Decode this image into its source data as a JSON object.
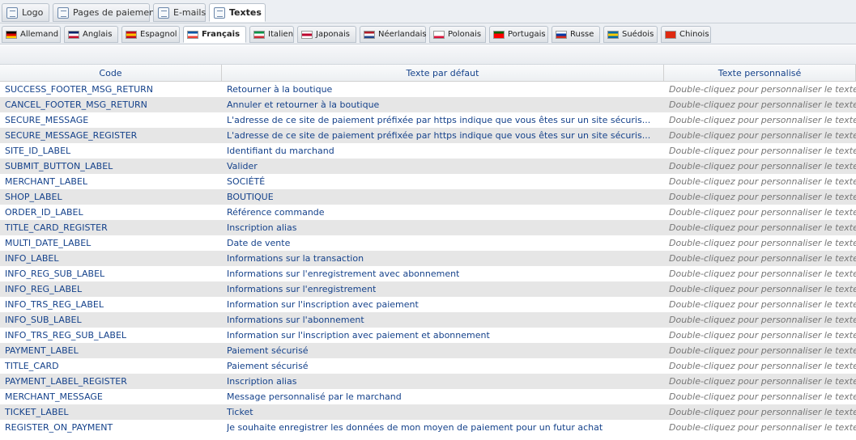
{
  "main_tabs": [
    {
      "label": "Logo",
      "icon": "image-icon"
    },
    {
      "label": "Pages de paiement",
      "icon": "page-edit-icon"
    },
    {
      "label": "E-mails",
      "icon": "email-icon"
    },
    {
      "label": "Textes",
      "icon": "text-icon",
      "active": true
    }
  ],
  "language_tabs": [
    {
      "label": "Allemand",
      "flag": [
        "#000000",
        "#dd0000",
        "#ffce00"
      ]
    },
    {
      "label": "Anglais",
      "flag": [
        "#012169",
        "#ffffff",
        "#c8102e"
      ]
    },
    {
      "label": "Espagnol",
      "flag": [
        "#c60b1e",
        "#ffc400",
        "#c60b1e"
      ]
    },
    {
      "label": "Français",
      "flag": [
        "#0055a4",
        "#ffffff",
        "#ef4135"
      ],
      "active": true
    },
    {
      "label": "Italien",
      "flag": [
        "#009246",
        "#ffffff",
        "#ce2b37"
      ]
    },
    {
      "label": "Japonais",
      "flag": [
        "#ffffff",
        "#bc002d",
        "#ffffff"
      ]
    },
    {
      "label": "Néerlandais",
      "flag": [
        "#ae1c28",
        "#ffffff",
        "#21468b"
      ]
    },
    {
      "label": "Polonais",
      "flag": [
        "#ffffff",
        "#ffffff",
        "#dc143c"
      ]
    },
    {
      "label": "Portugais",
      "flag": [
        "#006600",
        "#ff0000",
        "#ff0000"
      ]
    },
    {
      "label": "Russe",
      "flag": [
        "#ffffff",
        "#0039a6",
        "#d52b1e"
      ]
    },
    {
      "label": "Suédois",
      "flag": [
        "#006aa7",
        "#fecc00",
        "#006aa7"
      ]
    },
    {
      "label": "Chinois",
      "flag": [
        "#de2910",
        "#de2910",
        "#de2910"
      ]
    }
  ],
  "grid": {
    "headers": {
      "code": "Code",
      "default": "Texte par défaut",
      "custom": "Texte personnalisé"
    },
    "rows": [
      {
        "code": "SUCCESS_FOOTER_MSG_RETURN",
        "default": "Retourner à la boutique",
        "custom": "Double-cliquez pour personnaliser le texte"
      },
      {
        "code": "CANCEL_FOOTER_MSG_RETURN",
        "default": "Annuler et retourner à la boutique",
        "custom": "Double-cliquez pour personnaliser le texte"
      },
      {
        "code": "SECURE_MESSAGE",
        "default": "L'adresse de ce site de paiement préfixée par https indique que vous êtes sur un site sécuris...",
        "custom": "Double-cliquez pour personnaliser le texte"
      },
      {
        "code": "SECURE_MESSAGE_REGISTER",
        "default": "L'adresse de ce site de paiement préfixée par https indique que vous êtes sur un site sécuris...",
        "custom": "Double-cliquez pour personnaliser le texte"
      },
      {
        "code": "SITE_ID_LABEL",
        "default": "Identifiant du marchand",
        "custom": "Double-cliquez pour personnaliser le texte"
      },
      {
        "code": "SUBMIT_BUTTON_LABEL",
        "default": "Valider",
        "custom": "Double-cliquez pour personnaliser le texte"
      },
      {
        "code": "MERCHANT_LABEL",
        "default": "SOCIÉTÉ",
        "custom": "Double-cliquez pour personnaliser le texte"
      },
      {
        "code": "SHOP_LABEL",
        "default": "BOUTIQUE",
        "custom": "Double-cliquez pour personnaliser le texte"
      },
      {
        "code": "ORDER_ID_LABEL",
        "default": "Référence commande",
        "custom": "Double-cliquez pour personnaliser le texte"
      },
      {
        "code": "TITLE_CARD_REGISTER",
        "default": "Inscription alias",
        "custom": "Double-cliquez pour personnaliser le texte"
      },
      {
        "code": "MULTI_DATE_LABEL",
        "default": "Date de vente",
        "custom": "Double-cliquez pour personnaliser le texte"
      },
      {
        "code": "INFO_LABEL",
        "default": "Informations sur la transaction",
        "custom": "Double-cliquez pour personnaliser le texte"
      },
      {
        "code": "INFO_REG_SUB_LABEL",
        "default": "Informations sur l'enregistrement avec abonnement",
        "custom": "Double-cliquez pour personnaliser le texte"
      },
      {
        "code": "INFO_REG_LABEL",
        "default": "Informations sur l'enregistrement",
        "custom": "Double-cliquez pour personnaliser le texte"
      },
      {
        "code": "INFO_TRS_REG_LABEL",
        "default": "Information sur l'inscription avec paiement",
        "custom": "Double-cliquez pour personnaliser le texte"
      },
      {
        "code": "INFO_SUB_LABEL",
        "default": "Informations sur l'abonnement",
        "custom": "Double-cliquez pour personnaliser le texte"
      },
      {
        "code": "INFO_TRS_REG_SUB_LABEL",
        "default": "Information sur l'inscription avec paiement et abonnement",
        "custom": "Double-cliquez pour personnaliser le texte"
      },
      {
        "code": "PAYMENT_LABEL",
        "default": "Paiement sécurisé",
        "custom": "Double-cliquez pour personnaliser le texte"
      },
      {
        "code": "TITLE_CARD",
        "default": "Paiement sécurisé",
        "custom": "Double-cliquez pour personnaliser le texte"
      },
      {
        "code": "PAYMENT_LABEL_REGISTER",
        "default": "Inscription alias",
        "custom": "Double-cliquez pour personnaliser le texte"
      },
      {
        "code": "MERCHANT_MESSAGE",
        "default": "Message personnalisé par le marchand",
        "custom": "Double-cliquez pour personnaliser le texte"
      },
      {
        "code": "TICKET_LABEL",
        "default": "Ticket",
        "custom": "Double-cliquez pour personnaliser le texte"
      },
      {
        "code": "REGISTER_ON_PAYMENT",
        "default": "Je souhaite enregistrer les données de mon moyen de paiement pour un futur achat",
        "custom": "Double-cliquez pour personnaliser le texte"
      }
    ]
  }
}
